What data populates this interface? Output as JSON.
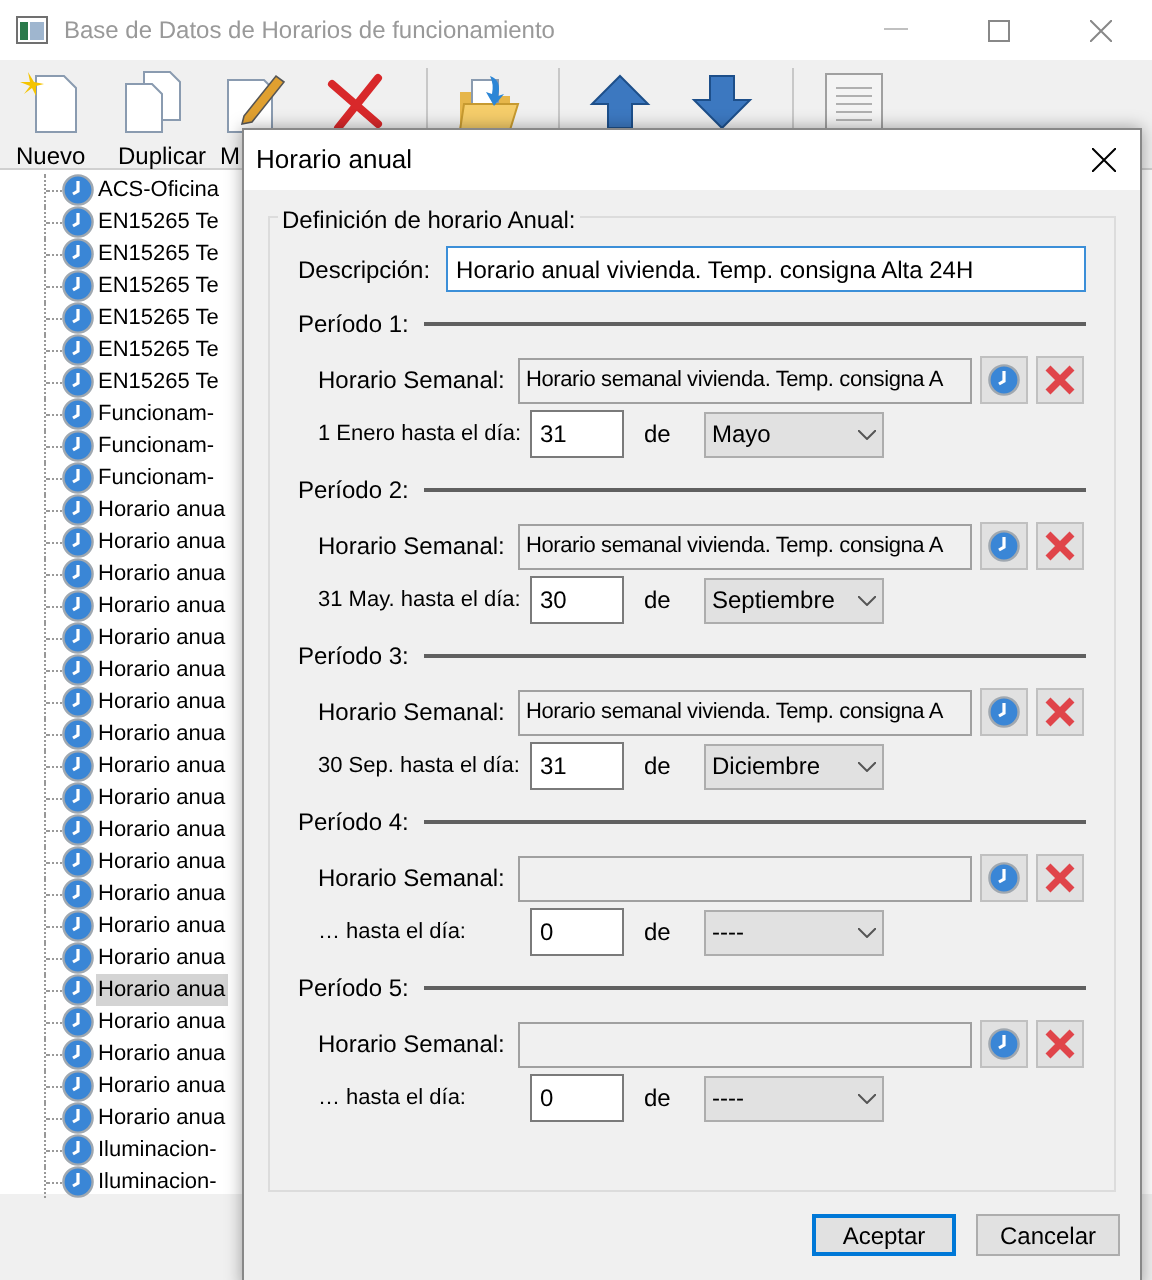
{
  "window": {
    "title": "Base de Datos de Horarios de funcionamiento"
  },
  "toolbar": [
    {
      "kind": "new",
      "label": "Nuevo"
    },
    {
      "kind": "duplicate",
      "label": "Duplicar"
    },
    {
      "kind": "edit",
      "label": "M"
    },
    {
      "kind": "delete"
    },
    {
      "kind": "import"
    },
    {
      "kind": "up"
    },
    {
      "kind": "down"
    },
    {
      "kind": "list"
    }
  ],
  "tree": {
    "items": [
      {
        "label": "ACS-Oficina",
        "selected": false
      },
      {
        "label": "EN15265 Te",
        "selected": false
      },
      {
        "label": "EN15265 Te",
        "selected": false
      },
      {
        "label": "EN15265 Te",
        "selected": false
      },
      {
        "label": "EN15265 Te",
        "selected": false
      },
      {
        "label": "EN15265 Te",
        "selected": false
      },
      {
        "label": "EN15265 Te",
        "selected": false
      },
      {
        "label": "Funcionam-",
        "selected": false
      },
      {
        "label": "Funcionam-",
        "selected": false
      },
      {
        "label": "Funcionam-",
        "selected": false
      },
      {
        "label": "Horario anua",
        "selected": false
      },
      {
        "label": "Horario anua",
        "selected": false
      },
      {
        "label": "Horario anua",
        "selected": false
      },
      {
        "label": "Horario anua",
        "selected": false
      },
      {
        "label": "Horario anua",
        "selected": false
      },
      {
        "label": "Horario anua",
        "selected": false
      },
      {
        "label": "Horario anua",
        "selected": false
      },
      {
        "label": "Horario anua",
        "selected": false
      },
      {
        "label": "Horario anua",
        "selected": false
      },
      {
        "label": "Horario anua",
        "selected": false
      },
      {
        "label": "Horario anua",
        "selected": false
      },
      {
        "label": "Horario anua",
        "selected": false
      },
      {
        "label": "Horario anua",
        "selected": false
      },
      {
        "label": "Horario anua",
        "selected": false
      },
      {
        "label": "Horario anua",
        "selected": false
      },
      {
        "label": "Horario anua",
        "selected": true
      },
      {
        "label": "Horario anua",
        "selected": false
      },
      {
        "label": "Horario anua",
        "selected": false
      },
      {
        "label": "Horario anua",
        "selected": false
      },
      {
        "label": "Horario anua",
        "selected": false
      },
      {
        "label": "Iluminacion-",
        "selected": false
      },
      {
        "label": "Iluminacion-",
        "selected": false
      }
    ]
  },
  "dialog": {
    "title": "Horario anual",
    "group_title": "Definición de horario Anual:",
    "description": {
      "label": "Descripción:",
      "value": "Horario anual vivienda. Temp. consigna Alta 24H"
    },
    "periods": [
      {
        "title": "Período 1:",
        "weekly_label": "Horario Semanal:",
        "weekly_value": "Horario semanal vivienda. Temp. consigna A",
        "from_label": "1 Enero hasta el día:",
        "day": "31",
        "of_label": "de",
        "month": "Mayo"
      },
      {
        "title": "Período 2:",
        "weekly_label": "Horario Semanal:",
        "weekly_value": "Horario semanal vivienda. Temp. consigna A",
        "from_label": "31 May. hasta el día:",
        "day": "30",
        "of_label": "de",
        "month": "Septiembre"
      },
      {
        "title": "Período 3:",
        "weekly_label": "Horario Semanal:",
        "weekly_value": "Horario semanal vivienda. Temp. consigna A",
        "from_label": "30 Sep. hasta el día:",
        "day": "31",
        "of_label": "de",
        "month": "Diciembre"
      },
      {
        "title": "Período 4:",
        "weekly_label": "Horario Semanal:",
        "from_label": "… hasta el día:",
        "day": "0",
        "of_label": "de",
        "month": "----"
      },
      {
        "title": "Período 5:",
        "weekly_label": "Horario Semanal:",
        "from_label": "… hasta el día:",
        "day": "0",
        "of_label": "de",
        "month": "----"
      }
    ],
    "buttons": [
      {
        "label": "Aceptar",
        "kind": "default"
      },
      {
        "label": "Cancelar",
        "kind": "normal"
      }
    ]
  }
}
